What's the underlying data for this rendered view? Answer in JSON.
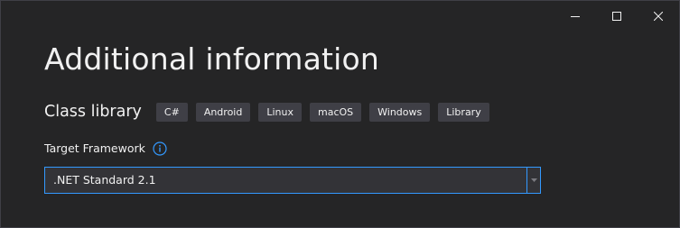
{
  "dialog": {
    "title": "Additional information"
  },
  "template": {
    "name": "Class library",
    "tags": [
      "C#",
      "Android",
      "Linux",
      "macOS",
      "Windows",
      "Library"
    ]
  },
  "target_framework": {
    "label": "Target Framework",
    "selected": ".NET Standard 2.1"
  },
  "window_controls": {
    "icons": [
      "minimize-icon",
      "maximize-icon",
      "close-icon"
    ]
  },
  "colors": {
    "background": "#252526",
    "text": "#f1f1f1",
    "tag_background": "#3f3f46",
    "accent": "#3399ff",
    "input_background": "#333337"
  }
}
